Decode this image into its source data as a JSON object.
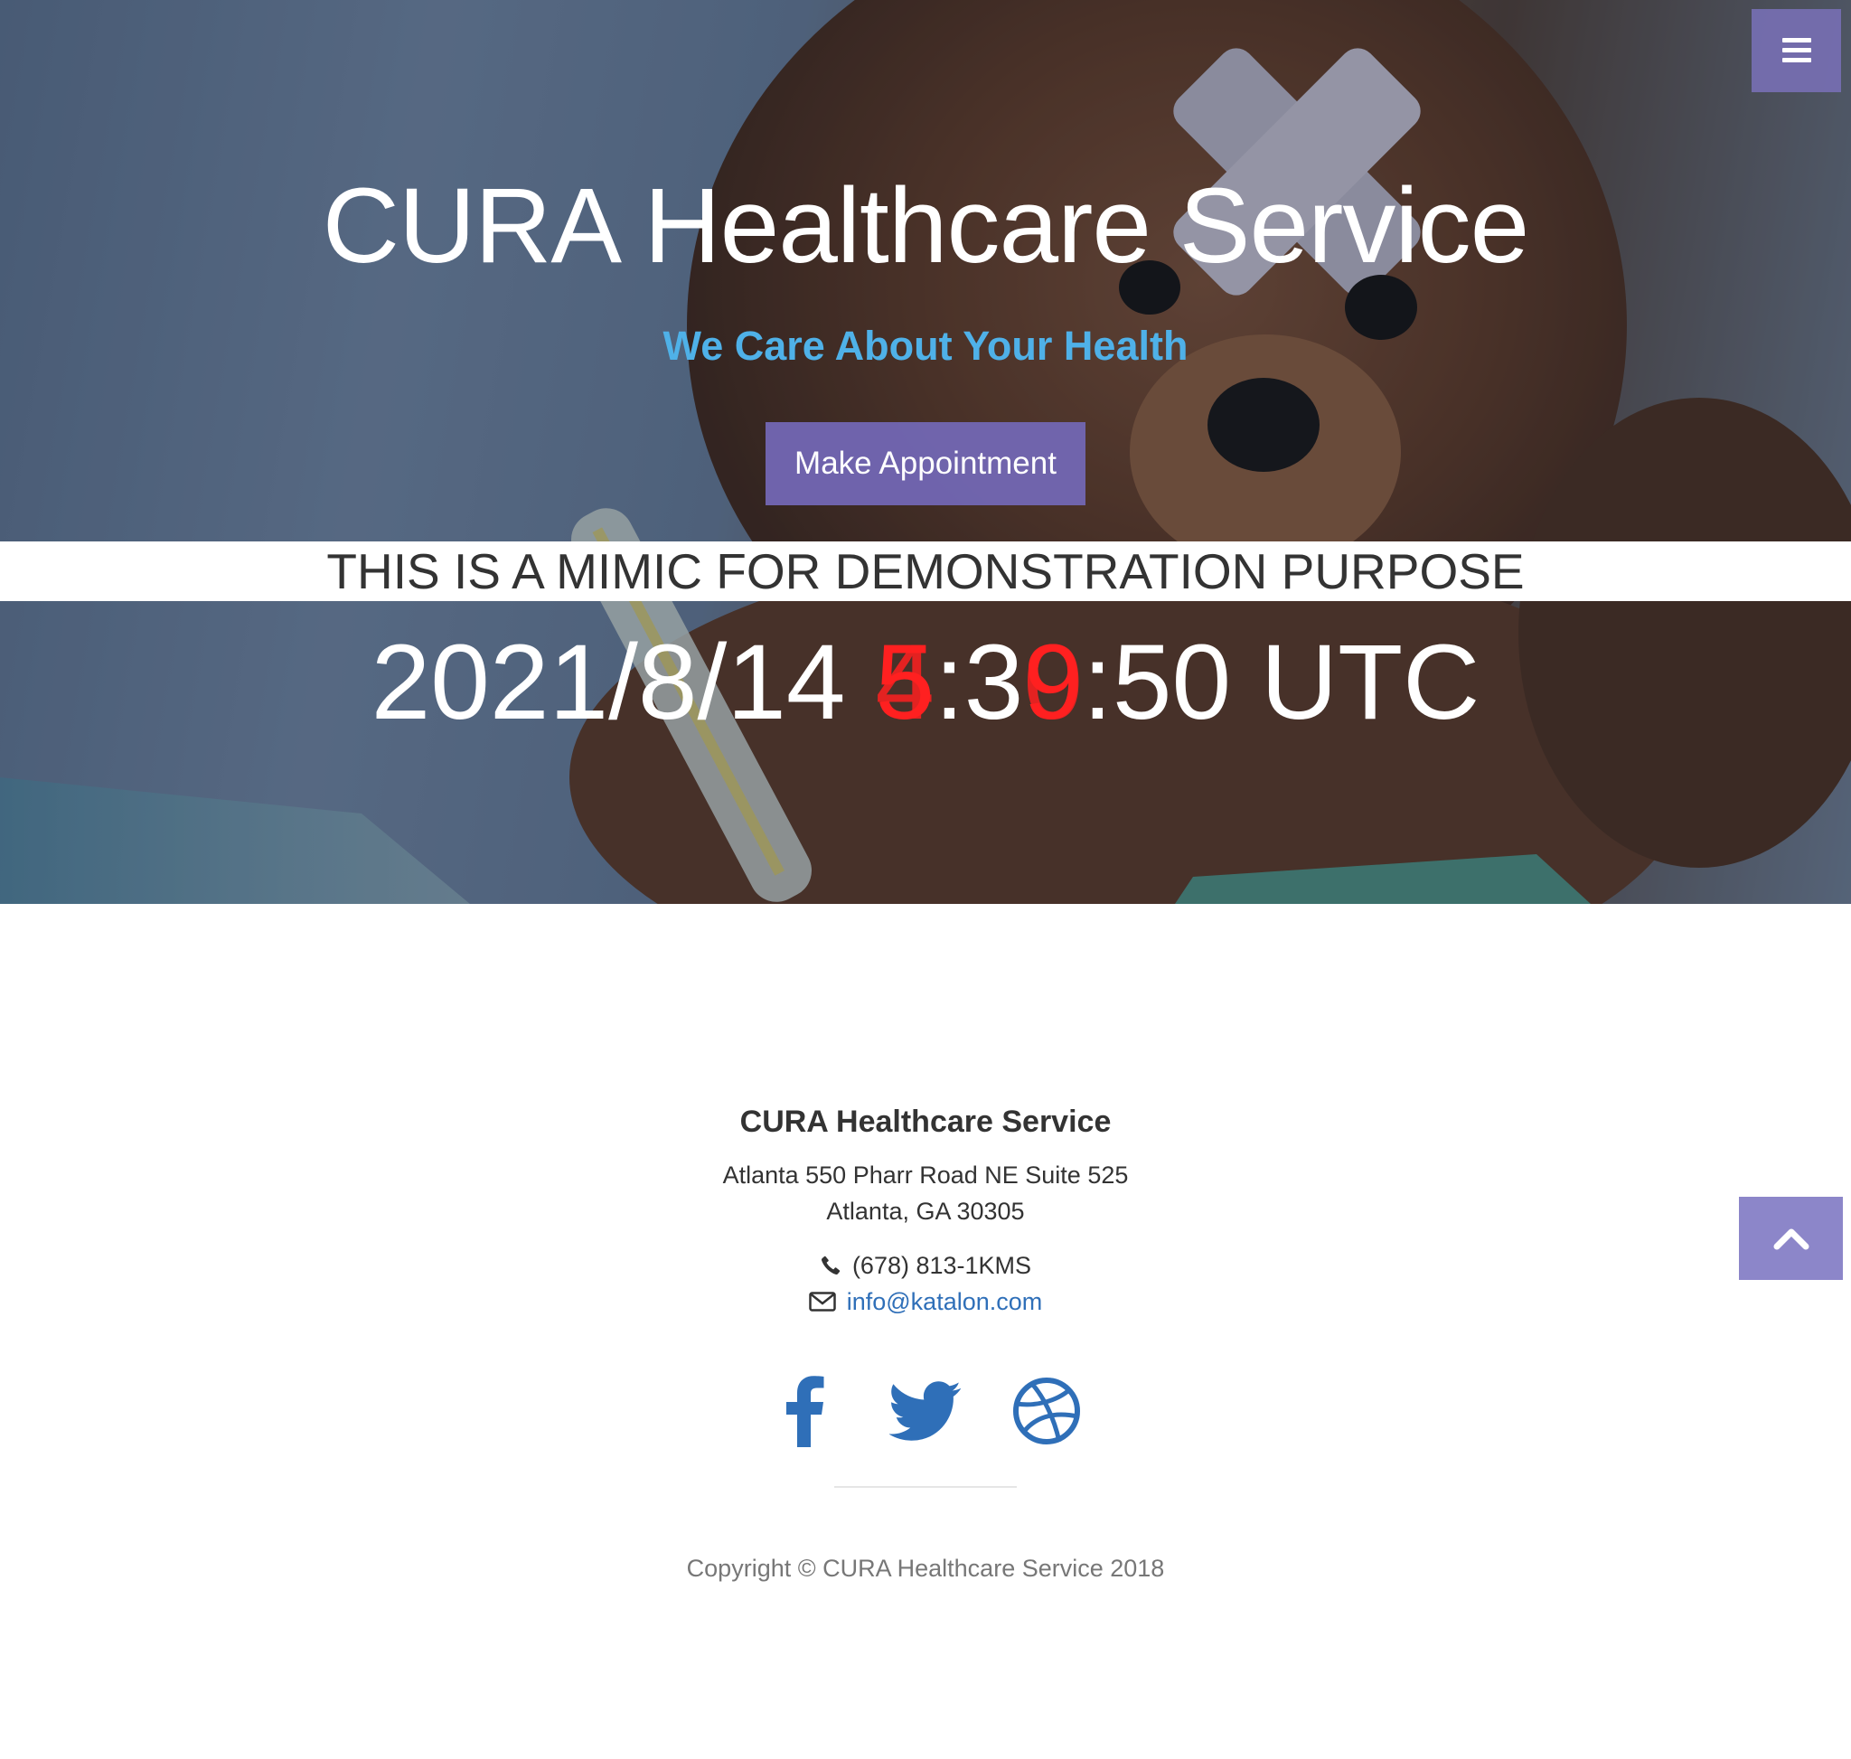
{
  "hero": {
    "title": "CURA Healthcare Service",
    "subtitle": "We Care About Your Health",
    "appointment_button_label": "Make Appointment",
    "demo_banner": "THIS IS A MIMIC FOR DEMONSTRATION PURPOSE",
    "clock": {
      "date": "2021/8/14 ",
      "hour_overlapped": [
        "5",
        "4"
      ],
      "sep1": ":",
      "minute_prefix": "3",
      "minute_overlapped": [
        "9",
        "0"
      ],
      "rest": ":50 UTC"
    }
  },
  "header": {
    "menu_icon": "hamburger-icon"
  },
  "footer": {
    "title": "CURA Healthcare Service",
    "address_line1": "Atlanta 550 Pharr Road NE Suite 525",
    "address_line2": "Atlanta, GA 30305",
    "phone": "(678) 813-1KMS",
    "phone_icon": "phone-icon",
    "email": "info@katalon.com",
    "email_icon": "envelope-icon",
    "social": [
      {
        "icon": "facebook-icon"
      },
      {
        "icon": "twitter-icon"
      },
      {
        "icon": "dribbble-icon"
      }
    ],
    "copyright": "Copyright © CURA Healthcare Service 2018"
  },
  "scroll_top": {
    "icon": "chevron-up-icon"
  },
  "colors": {
    "accent": "#7166b2",
    "subtitle": "#4fb1e8",
    "link": "#2f6fb8",
    "clock_glitch": "#ff2020"
  }
}
